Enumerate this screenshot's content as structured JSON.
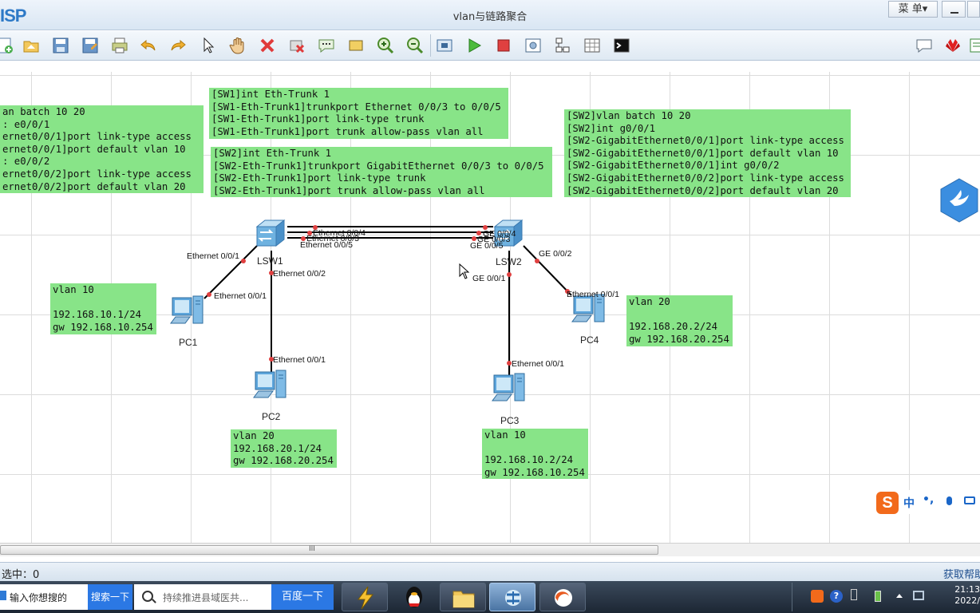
{
  "window": {
    "app_logo": "ISP",
    "title": "vlan与链路聚合",
    "menu_label": "菜 单▾"
  },
  "toolbar": {
    "icons": [
      "new-topology-icon",
      "open-icon",
      "save-icon",
      "save-as-icon",
      "print-icon",
      "undo-icon",
      "redo-icon",
      "select-pointer-icon",
      "pan-hand-icon",
      "delete-icon",
      "delete-link-icon",
      "text-note-icon",
      "rectangle-icon",
      "zoom-in-icon",
      "zoom-out-icon",
      "fit-window-icon",
      "start-device-icon",
      "stop-device-icon",
      "capture-icon",
      "topology-icon",
      "grid-icon",
      "cli-icon",
      "chat-icon",
      "huawei-icon"
    ]
  },
  "notes": {
    "sw1_vlan": "an batch 10 20\n: e0/0/1\nernet0/0/1]port link-type access\nernet0/0/1]port default vlan 10\n: e0/0/2\nernet0/0/2]port link-type access\nernet0/0/2]port default vlan 20",
    "sw1_trunk": "[SW1]int Eth-Trunk 1\n[SW1-Eth-Trunk1]trunkport Ethernet 0/0/3 to 0/0/5\n[SW1-Eth-Trunk1]port link-type trunk\n[SW1-Eth-Trunk1]port trunk allow-pass vlan all",
    "sw2_trunk": "[SW2]int Eth-Trunk 1\n[SW2-Eth-Trunk1]trunkport GigabitEthernet 0/0/3 to 0/0/5\n[SW2-Eth-Trunk1]port link-type trunk\n[SW2-Eth-Trunk1]port trunk allow-pass vlan all",
    "sw2_vlan": "[SW2]vlan batch 10 20\n[SW2]int g0/0/1\n[SW2-GigabitEthernet0/0/1]port link-type access\n[SW2-GigabitEthernet0/0/1]port default vlan 10\n[SW2-GigabitEthernet0/0/1]int g0/0/2\n[SW2-GigabitEthernet0/0/2]port link-type access\n[SW2-GigabitEthernet0/0/2]port default vlan 20",
    "pc1": "vlan 10\n\n192.168.10.1/24\ngw 192.168.10.254",
    "pc2": "vlan 20\n192.168.20.1/24\ngw 192.168.20.254",
    "pc3": "vlan 10\n\n192.168.10.2/24\ngw 192.168.10.254",
    "pc4": "vlan 20\n\n192.168.20.2/24\ngw 192.168.20.254"
  },
  "devices": {
    "lsw1": "LSW1",
    "lsw2": "LSW2",
    "pc1": "PC1",
    "pc2": "PC2",
    "pc3": "PC3",
    "pc4": "PC4"
  },
  "ports": {
    "lsw1_e001": "Ethernet 0/0/1",
    "lsw1_e002": "Ethernet 0/0/2",
    "lsw1_e003": "Ethernet 0/0/3",
    "lsw1_e004": "Ethernet 0/0/4",
    "lsw1_e005": "Ethernet 0/0/5",
    "lsw2_ge001": "GE 0/0/1",
    "lsw2_ge002": "GE 0/0/2",
    "lsw2_ge003": "GE 0/0/3",
    "lsw2_ge004": "GE 0/0/4",
    "lsw2_ge005": "GE 0/0/5",
    "pc1_e001": "Ethernet 0/0/1",
    "pc2_e001": "Ethernet 0/0/1",
    "pc3_e001": "Ethernet 0/0/1",
    "pc4_e001": "Ethernet 0/0/1"
  },
  "scrollbar": {
    "grip": "III"
  },
  "status": {
    "left": "选中：0",
    "right": "获取帮助"
  },
  "ime": {
    "lang": "中",
    "punct": "•,"
  },
  "taskbar": {
    "search1_placeholder": "输入你想搜的",
    "search1_button": "搜索一下",
    "search2_placeholder": "持续推进县域医共...",
    "search2_button": "百度一下",
    "clock_time": "21:13",
    "clock_date": "2022/"
  },
  "colors": {
    "note_bg": "#88e488",
    "link": "#000000",
    "port_dot": "#e04040",
    "accent": "#2b78e4"
  }
}
